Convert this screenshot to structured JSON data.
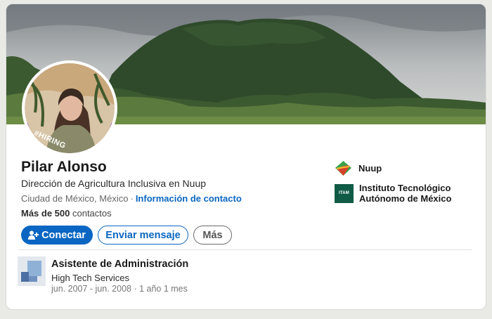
{
  "profile": {
    "badge": "#HIRING",
    "name": "Pilar Alonso",
    "headline": "Dirección de Agricultura Inclusiva en Nuup",
    "location": "Ciudad de México, México",
    "separator": "·",
    "contact_link": "Información de contacto",
    "connections_count": "Más de 500",
    "connections_label": " contactos"
  },
  "actions": {
    "connect_label": "Conectar",
    "message_label": "Enviar mensaje",
    "more_label": "Más"
  },
  "organizations": [
    {
      "name": "Nuup",
      "icon": "nuup-logo-icon"
    },
    {
      "name_line1": "Instituto Tecnológico",
      "name_line2": "Autónomo de México",
      "logo_text": "ITAM"
    }
  ],
  "experience": {
    "title": "Asistente de Administración",
    "company": "High Tech Services",
    "dates": "jun. 2007 - jun. 2008 · 1 año 1 mes"
  },
  "colors": {
    "primary": "#0a66c2",
    "hiring_purple": "#7b3fd6",
    "itam_green": "#0f5b45"
  }
}
